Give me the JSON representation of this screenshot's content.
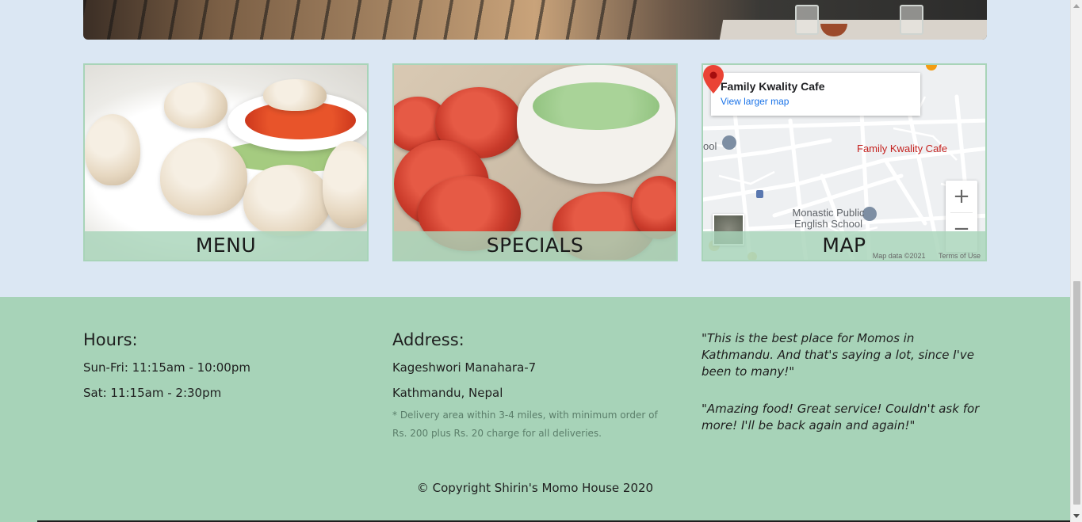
{
  "tiles": {
    "menu": {
      "label": "MENU"
    },
    "specials": {
      "label": "SPECIALS"
    },
    "map": {
      "label": "MAP",
      "place_name": "Family Kwality Cafe",
      "view_larger": "View larger map",
      "pin_label": "Family Kwality Cafe",
      "nearby_poi": "Monastic Public English School",
      "partial_poi": "ool",
      "zoom_in": "+",
      "zoom_out": "−",
      "attribution": "Map data ©2021",
      "terms": "Terms of Use"
    }
  },
  "footer": {
    "hours": {
      "heading": "Hours:",
      "lines": [
        "Sun-Fri: 11:15am - 10:00pm",
        "Sat: 11:15am - 2:30pm"
      ]
    },
    "address": {
      "heading": "Address:",
      "lines": [
        "Kageshwori Manahara-7",
        "Kathmandu, Nepal"
      ],
      "note": "* Delivery area within 3-4 miles, with minimum order of Rs. 200 plus Rs. 20 charge for all deliveries."
    },
    "reviews": [
      "\"This is the best place for Momos in Kathmandu. And that's saying a lot, since I've been to many!\"",
      "\"Amazing food! Great service! Couldn't ask for more! I'll be back again and again!\""
    ],
    "copyright": "© Copyright Shirin's Momo House 2020"
  },
  "colors": {
    "page_bg": "#dbe7f3",
    "footer_bg": "#a7d3b8",
    "tile_border": "#a8d4b8",
    "link": "#1a73e8",
    "pin": "#ea4335"
  },
  "icons": [
    "map-pin-icon",
    "school-icon",
    "bus-stop-icon",
    "zoom-in-icon",
    "zoom-out-icon"
  ]
}
